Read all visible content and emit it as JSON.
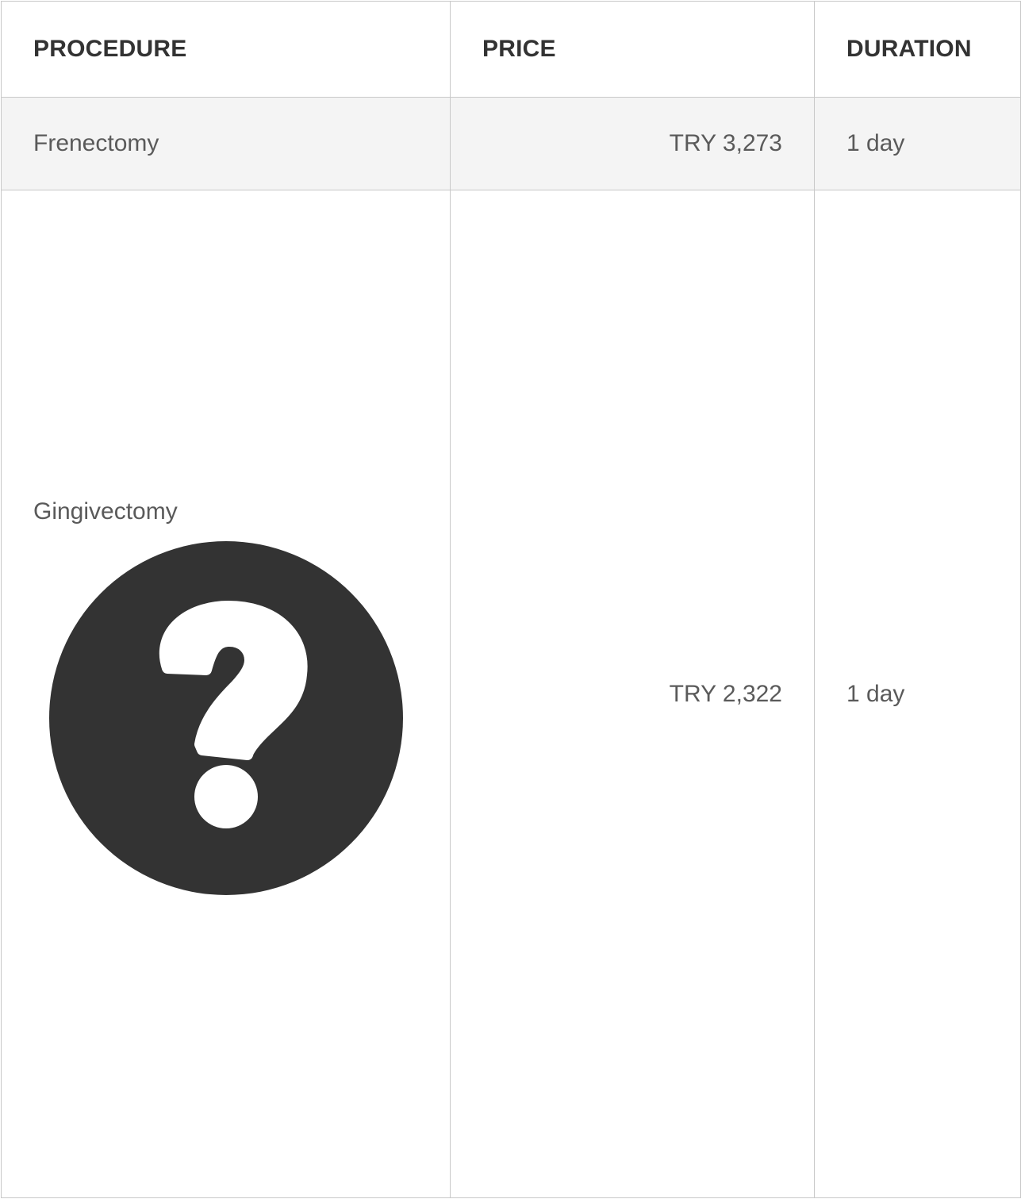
{
  "table": {
    "headers": {
      "procedure": "PROCEDURE",
      "price": "PRICE",
      "duration": "DURATION"
    },
    "rows": [
      {
        "procedure": "Frenectomy",
        "price": "TRY 3,273",
        "duration": "1 day",
        "has_image": false
      },
      {
        "procedure": "Gingivectomy",
        "price": "TRY 2,322",
        "duration": "1 day",
        "has_image": true,
        "image_icon": "question-circle-icon"
      }
    ]
  },
  "colors": {
    "header_text": "#333333",
    "body_text": "#5a5a5a",
    "row_alt_background": "#f4f4f4",
    "border": "#c8c8c8",
    "icon_fill": "#333333"
  }
}
